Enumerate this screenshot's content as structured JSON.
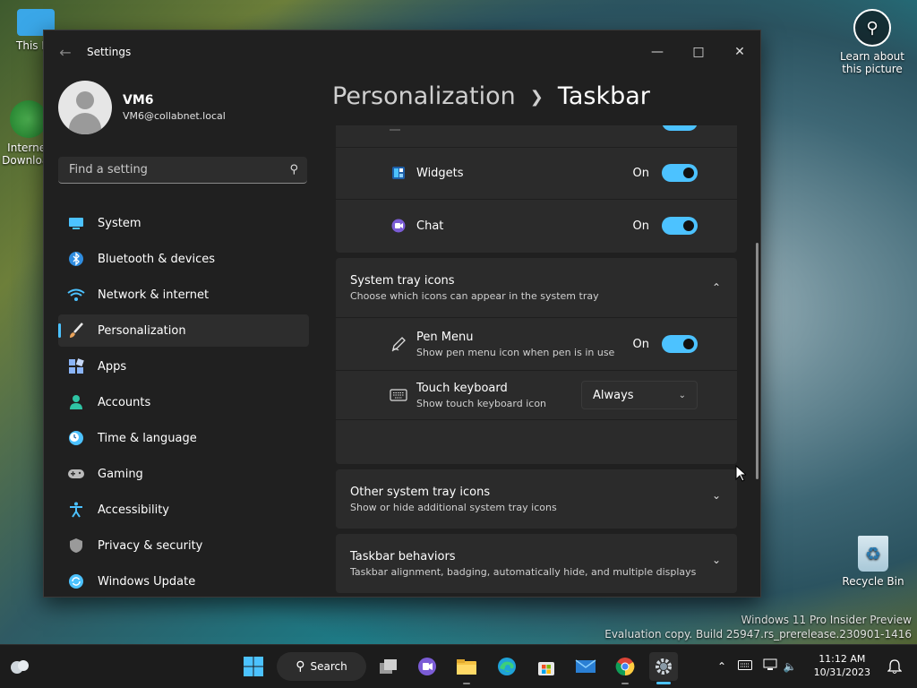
{
  "desktop": {
    "this_pc_label": "This PC",
    "internet_download_label": "Internet Download",
    "learn_label_line1": "Learn about",
    "learn_label_line2": "this picture",
    "recycle_label": "Recycle Bin",
    "watermark_line1": "Windows 11 Pro Insider Preview",
    "watermark_line2": "Evaluation copy. Build 25947.rs_prerelease.230901-1416"
  },
  "window": {
    "title": "Settings",
    "user": {
      "name": "VM6",
      "email": "VM6@collabnet.local"
    },
    "search": {
      "placeholder": "Find a setting"
    },
    "nav": [
      {
        "label": "System",
        "icon": "monitor-icon",
        "color": "#4cc2ff"
      },
      {
        "label": "Bluetooth & devices",
        "icon": "bluetooth-icon",
        "color": "#4cc2ff"
      },
      {
        "label": "Network & internet",
        "icon": "wifi-icon",
        "color": "#4cc2ff"
      },
      {
        "label": "Personalization",
        "icon": "brush-icon",
        "color": "#e8a25a",
        "active": true
      },
      {
        "label": "Apps",
        "icon": "apps-icon",
        "color": "#8ab4f8"
      },
      {
        "label": "Accounts",
        "icon": "person-icon",
        "color": "#2fc4a4"
      },
      {
        "label": "Time & language",
        "icon": "clock-globe-icon",
        "color": "#4cc2ff"
      },
      {
        "label": "Gaming",
        "icon": "gamepad-icon",
        "color": "#bbbbbb"
      },
      {
        "label": "Accessibility",
        "icon": "accessibility-icon",
        "color": "#4cc2ff"
      },
      {
        "label": "Privacy & security",
        "icon": "shield-icon",
        "color": "#9a9a9a"
      },
      {
        "label": "Windows Update",
        "icon": "update-icon",
        "color": "#4cc2ff"
      }
    ],
    "breadcrumb": {
      "parent": "Personalization",
      "current": "Taskbar"
    },
    "taskbar_items": {
      "widgets": {
        "label": "Widgets",
        "state": "On"
      },
      "chat": {
        "label": "Chat",
        "state": "On"
      }
    },
    "system_tray": {
      "title": "System tray icons",
      "description": "Choose which icons can appear in the system tray",
      "pen_menu": {
        "label": "Pen Menu",
        "description": "Show pen menu icon when pen is in use",
        "state": "On"
      },
      "touch_keyboard": {
        "label": "Touch keyboard",
        "description": "Show touch keyboard icon",
        "value": "Always"
      }
    },
    "other_tray": {
      "title": "Other system tray icons",
      "description": "Show or hide additional system tray icons"
    },
    "behaviors": {
      "title": "Taskbar behaviors",
      "description": "Taskbar alignment, badging, automatically hide, and multiple displays"
    }
  },
  "taskbar": {
    "search_label": "Search",
    "time": "11:12 AM",
    "date": "10/31/2023"
  }
}
